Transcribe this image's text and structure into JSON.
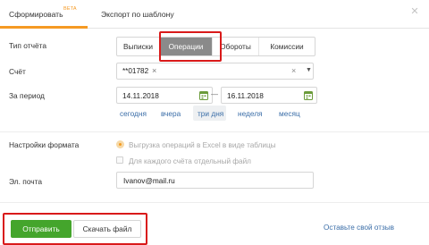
{
  "tabs": {
    "generate_label": "Сформировать",
    "generate_badge": "BETA",
    "template_label": "Экспорт по шаблону"
  },
  "form": {
    "report_type_label": "Тип отчёта",
    "report_types": [
      "Выписки",
      "Операции",
      "Обороты",
      "Комиссии"
    ],
    "report_type_selected": "Операции",
    "account_label": "Счёт",
    "account_value": "**01782",
    "period_label": "За период",
    "date_from": "14.11.2018",
    "date_dash": "—",
    "date_to": "16.11.2018",
    "quick_periods": [
      "сегодня",
      "вчера",
      "три дня",
      "неделя",
      "месяц"
    ],
    "quick_period_selected": "три дня",
    "format_label": "Настройки формата",
    "format_option_excel": "Выгрузка операций в Excel в виде таблицы",
    "format_option_separate": "Для каждого счёта отдельный файл",
    "email_label": "Эл. почта",
    "email_value": "Ivanov@mail.ru"
  },
  "footer": {
    "send_label": "Отправить",
    "download_label": "Скачать файл",
    "feedback_label": "Оставьте свой отзыв"
  },
  "icons": {
    "close": "close-icon",
    "chip_remove": "chip-remove-icon",
    "clear": "clear-icon",
    "dropdown": "chevron-down-icon",
    "calendar": "calendar-icon"
  },
  "colors": {
    "accent": "#f59a23",
    "primary_button": "#44a52c",
    "link": "#3b6ea8",
    "segment_active": "#8a8a8a",
    "highlight": "#d91a1a"
  }
}
